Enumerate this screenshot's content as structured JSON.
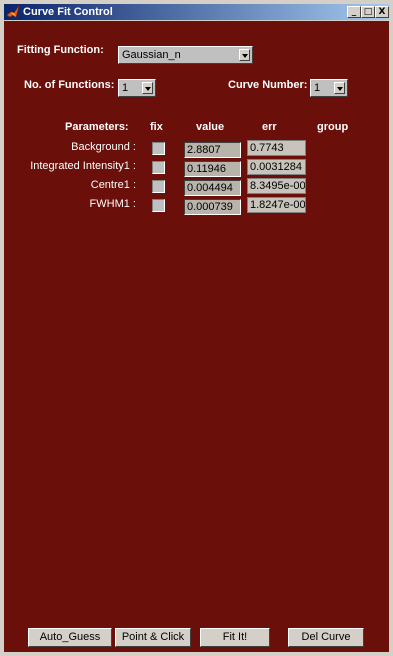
{
  "window": {
    "title": "Curve Fit Control",
    "controls": {
      "minimize": "_",
      "maximize": "□",
      "close": "X"
    }
  },
  "fitting_function": {
    "label": "Fitting Function:",
    "value": "Gaussian_n"
  },
  "num_functions": {
    "label": "No. of Functions:",
    "value": "1"
  },
  "curve_number": {
    "label": "Curve Number:",
    "value": "1"
  },
  "table": {
    "headers": {
      "parameters": "Parameters:",
      "fix": "fix",
      "value": "value",
      "err": "err",
      "group": "group"
    },
    "rows": [
      {
        "label": "Background :",
        "fixed": false,
        "value": "2.8807",
        "err": "0.7743"
      },
      {
        "label": "Integrated Intensity1 :",
        "fixed": false,
        "value": "0.11946",
        "err": "0.0031284"
      },
      {
        "label": "Centre1 :",
        "fixed": false,
        "value": "0.004494",
        "err": "8.3495e-00"
      },
      {
        "label": "FWHM1 :",
        "fixed": false,
        "value": "0.000739",
        "err": "1.8247e-00"
      }
    ]
  },
  "buttons": {
    "auto_guess": "Auto_Guess",
    "point_click": "Point & Click",
    "fit": "Fit It!",
    "del_curve": "Del Curve"
  },
  "colors": {
    "panel_bg": "#6b0f0a",
    "titlebar_start": "#0a246a",
    "titlebar_end": "#a6caf0",
    "label_text": "#ffffff"
  },
  "icons": {
    "app": "matlab-logo-icon",
    "combo_arrow": "chevron-down-icon"
  }
}
